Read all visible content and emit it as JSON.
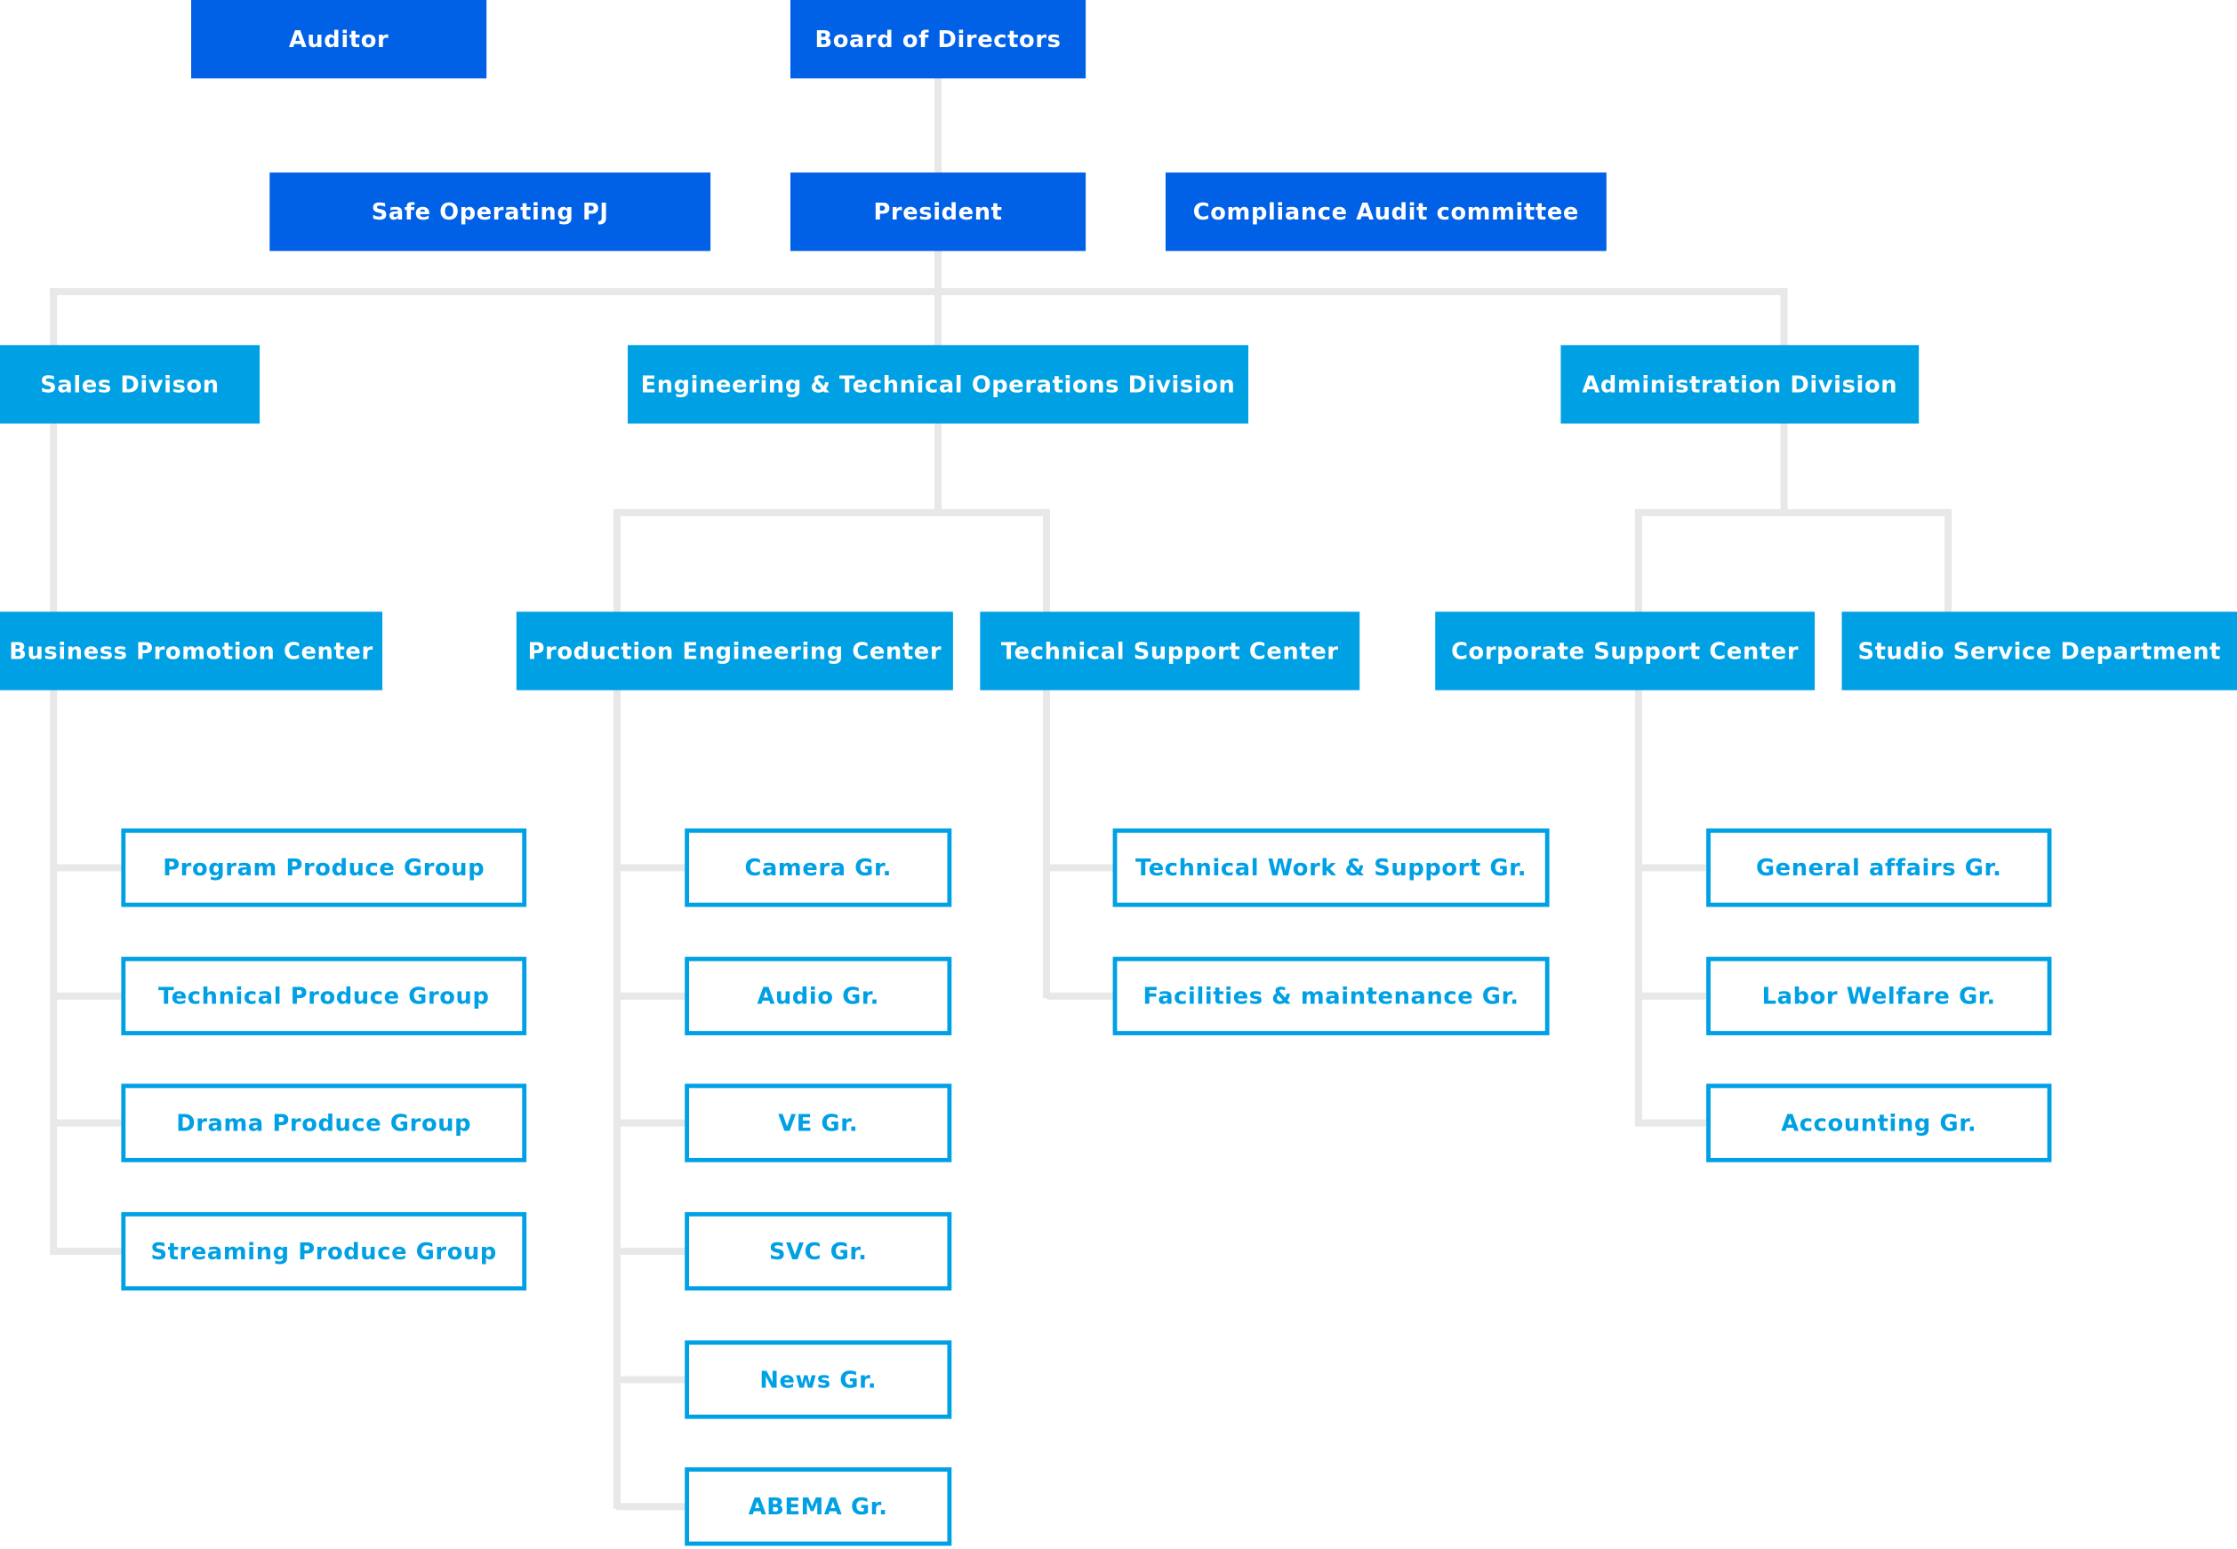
{
  "colors": {
    "executive": "#0060e6",
    "division": "#00a0e4",
    "connector": "#e8e8e8"
  },
  "top": {
    "auditor": "Auditor",
    "board": "Board of Directors",
    "safe_pj": "Safe Operating PJ",
    "president": "President",
    "compliance": "Compliance Audit committee"
  },
  "divisions": {
    "sales": "Sales Divison",
    "engineering": "Engineering & Technical Operations Division",
    "administration": "Administration Division"
  },
  "centers": {
    "business_promotion": "Business Promotion Center",
    "production_engineering": "Production Engineering Center",
    "technical_support": "Technical Support Center",
    "corporate_support": "Corporate Support Center",
    "studio_service": "Studio Service Department"
  },
  "groups": {
    "business_promotion": [
      "Program Produce Group",
      "Technical Produce Group",
      "Drama Produce Group",
      "Streaming Produce Group"
    ],
    "production_engineering": [
      "Camera Gr.",
      "Audio Gr.",
      "VE Gr.",
      "SVC Gr.",
      "News Gr.",
      "ABEMA Gr."
    ],
    "technical_support": [
      "Technical Work & Support Gr.",
      "Facilities & maintenance Gr."
    ],
    "corporate_support": [
      "General affairs Gr.",
      "Labor Welfare Gr.",
      "Accounting Gr."
    ]
  }
}
